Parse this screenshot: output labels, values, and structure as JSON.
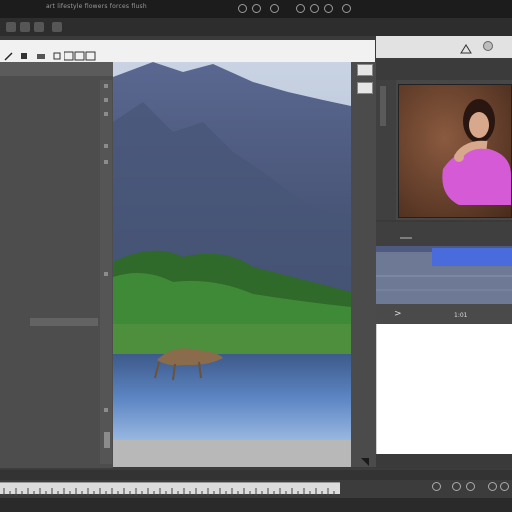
{
  "window": {
    "title": "art lifestyle flowers forces flush"
  },
  "colors": {
    "titlebar": "#1c1c1c",
    "panel": "#4d4d4d",
    "accent_blue": "#4a6bdc",
    "thumb_dress": "#d45ad6"
  },
  "icons": {
    "toolbar": [
      "circle-icon",
      "gear-icon",
      "clock-icon",
      "question-icon",
      "grid-icon",
      "link-icon",
      "eye-icon"
    ],
    "options": [
      "pen-icon",
      "brush-icon",
      "layers-icon"
    ],
    "right_top": [
      "camera-icon",
      "close-icon"
    ]
  },
  "right_panel": {
    "play_glyph": ">",
    "nav_label": "1:01"
  }
}
